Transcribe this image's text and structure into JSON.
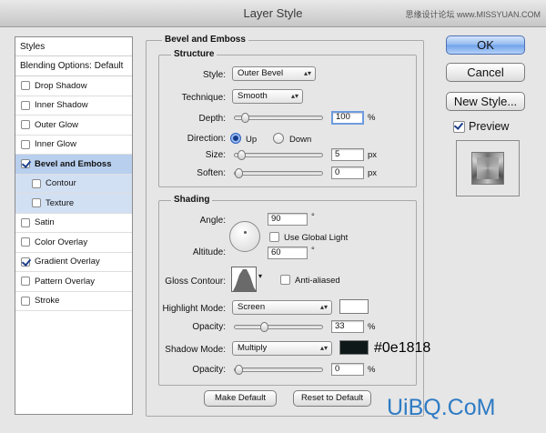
{
  "window": {
    "title": "Layer Style",
    "watermark": "思缘设计论坛 www.MISSYUAN.COM"
  },
  "styles_panel": {
    "header": "Styles",
    "blending_options": "Blending Options: Default",
    "items": [
      {
        "label": "Drop Shadow",
        "checked": false
      },
      {
        "label": "Inner Shadow",
        "checked": false
      },
      {
        "label": "Outer Glow",
        "checked": false
      },
      {
        "label": "Inner Glow",
        "checked": false
      },
      {
        "label": "Bevel and Emboss",
        "checked": true
      },
      {
        "label": "Contour",
        "checked": false
      },
      {
        "label": "Texture",
        "checked": false
      },
      {
        "label": "Satin",
        "checked": false
      },
      {
        "label": "Color Overlay",
        "checked": false
      },
      {
        "label": "Gradient Overlay",
        "checked": true
      },
      {
        "label": "Pattern Overlay",
        "checked": false
      },
      {
        "label": "Stroke",
        "checked": false
      }
    ]
  },
  "bevel": {
    "section_title": "Bevel and Emboss",
    "structure": {
      "title": "Structure",
      "style_label": "Style:",
      "style_value": "Outer Bevel",
      "technique_label": "Technique:",
      "technique_value": "Smooth",
      "depth_label": "Depth:",
      "depth_value": "100",
      "depth_unit": "%",
      "depth_fraction": 0.08,
      "direction_label": "Direction:",
      "dir_up": "Up",
      "dir_down": "Down",
      "size_label": "Size:",
      "size_value": "5",
      "size_unit": "px",
      "size_fraction": 0.03,
      "soften_label": "Soften:",
      "soften_value": "0",
      "soften_unit": "px",
      "soften_fraction": 0.0
    },
    "shading": {
      "title": "Shading",
      "angle_label": "Angle:",
      "angle_value": "90",
      "angle_unit": "°",
      "use_global_light": "Use Global Light",
      "altitude_label": "Altitude:",
      "altitude_value": "60",
      "altitude_unit": "°",
      "gloss_label": "Gloss Contour:",
      "anti_aliased": "Anti-aliased",
      "highlight_mode_label": "Highlight Mode:",
      "highlight_mode_value": "Screen",
      "highlight_color": "#ffffff",
      "highlight_opacity_label": "Opacity:",
      "highlight_opacity_value": "33",
      "highlight_opacity_unit": "%",
      "highlight_opacity_fraction": 0.33,
      "shadow_mode_label": "Shadow Mode:",
      "shadow_mode_value": "Multiply",
      "shadow_color": "#0e1818",
      "shadow_opacity_label": "Opacity:",
      "shadow_opacity_value": "0",
      "shadow_opacity_unit": "%",
      "shadow_opacity_fraction": 0.0
    },
    "make_default": "Make Default",
    "reset_default": "Reset to Default"
  },
  "buttons": {
    "ok": "OK",
    "cancel": "Cancel",
    "new_style": "New Style...",
    "preview": "Preview"
  },
  "annotation": "#0e1818",
  "brand": "UiBQ.CoM"
}
